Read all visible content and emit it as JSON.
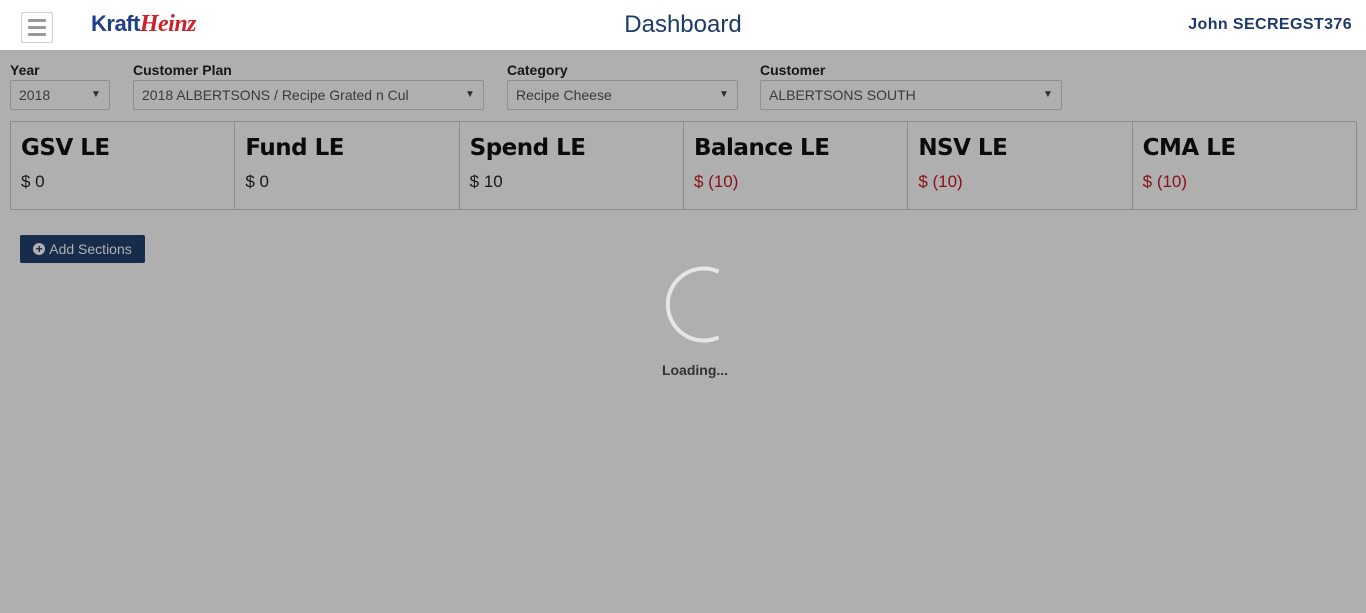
{
  "header": {
    "logo_part1": "Kraft",
    "logo_part2": "Heinz",
    "title": "Dashboard",
    "user": "John SECREGST376"
  },
  "filters": {
    "year": {
      "label": "Year",
      "value": "2018"
    },
    "customer_plan": {
      "label": "Customer Plan",
      "value": "2018 ALBERTSONS / Recipe Grated n Cul"
    },
    "category": {
      "label": "Category",
      "value": "Recipe Cheese"
    },
    "customer": {
      "label": "Customer",
      "value": "ALBERTSONS SOUTH"
    }
  },
  "kpis": [
    {
      "title": "GSV LE",
      "value": "$ 0"
    },
    {
      "title": "Fund LE",
      "value": "$ 0"
    },
    {
      "title": "Spend LE",
      "value": "$ 10"
    },
    {
      "title": "Balance LE",
      "value": "$ (10)"
    },
    {
      "title": "NSV LE",
      "value": "$ (10)"
    },
    {
      "title": "CMA LE",
      "value": "$ (10)"
    }
  ],
  "actions": {
    "add_sections": "Add Sections"
  },
  "loading": {
    "text": "Loading..."
  },
  "colors": {
    "brand_navy": "#22406e",
    "negative": "#c9191f",
    "logo_red": "#d0202a"
  }
}
